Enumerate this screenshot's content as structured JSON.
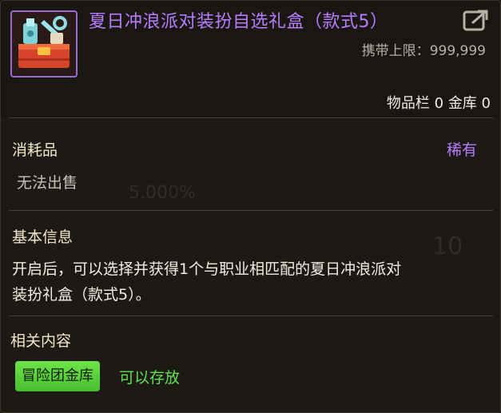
{
  "item": {
    "title": "夏日冲浪派对装扮自选礼盒（款式5）",
    "icon": "gift-box-icon",
    "carry_limit_label": "携带上限：",
    "carry_limit_value": "999,999",
    "inventory_label": "物品栏",
    "inventory_count": "0",
    "vault_label": "金库",
    "vault_count": "0"
  },
  "consumable": {
    "category": "消耗品",
    "rarity": "稀有",
    "sell_status": "无法出售"
  },
  "basic_info": {
    "title": "基本信息",
    "description_line1": "开启后，可以选择并获得1个与职业相匹配的夏日冲浪派对",
    "description_line2": "装扮礼盒（款式5）。"
  },
  "related": {
    "title": "相关内容",
    "button_label": "冒险团金库",
    "status": "可以存放"
  },
  "colors": {
    "rarity_purple": "#b77cff",
    "storable_green": "#5fe24a",
    "button_green": "#55c93a"
  }
}
